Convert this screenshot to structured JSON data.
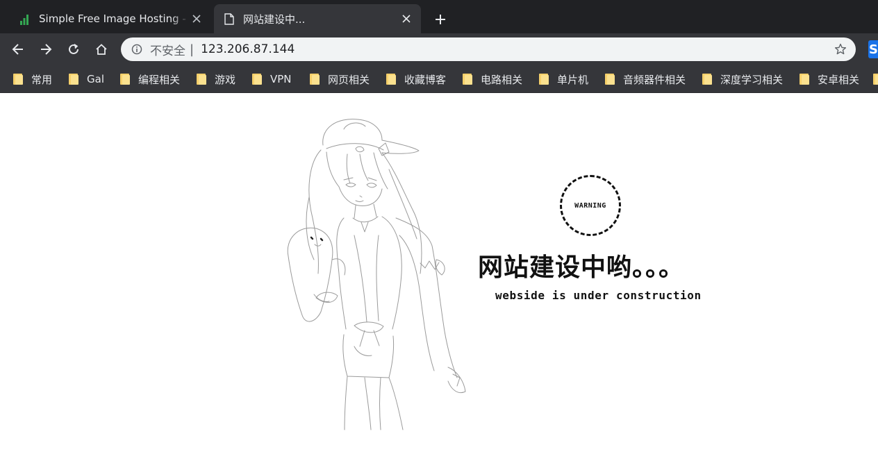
{
  "browser": {
    "tabs": [
      {
        "title": "Simple Free Image Hosting - S",
        "icon": "bar-chart-favicon-icon",
        "active": false
      },
      {
        "title": "网站建设中...",
        "icon": "document-icon",
        "active": true
      }
    ],
    "new_tab_icon": "plus-icon",
    "nav": {
      "back_icon": "arrow-left-icon",
      "forward_icon": "arrow-right-icon",
      "reload_icon": "reload-icon",
      "home_icon": "home-icon"
    },
    "omnibox": {
      "security_label": "不安全",
      "separator": "|",
      "url": "123.206.87.144",
      "star_icon": "star-icon"
    },
    "extension_letter": "S",
    "bookmarks": [
      {
        "label": "常用"
      },
      {
        "label": "Gal"
      },
      {
        "label": "编程相关"
      },
      {
        "label": "游戏"
      },
      {
        "label": "VPN"
      },
      {
        "label": "网页相关"
      },
      {
        "label": "收藏博客"
      },
      {
        "label": "电路相关"
      },
      {
        "label": "单片机"
      },
      {
        "label": "音频器件相关"
      },
      {
        "label": "深度学习相关"
      },
      {
        "label": "安卓相关"
      }
    ]
  },
  "page": {
    "badge_text": "WARNING",
    "headline": "网站建设中哟。。。",
    "subline": "webside is under construction"
  },
  "colors": {
    "tabstrip_bg": "#202124",
    "toolbar_bg": "#35363a",
    "omnibox_bg": "#f1f3f4",
    "folder_yellow": "#f6d06b",
    "favicon_green": "#34a853",
    "text_dark": "#111111"
  }
}
